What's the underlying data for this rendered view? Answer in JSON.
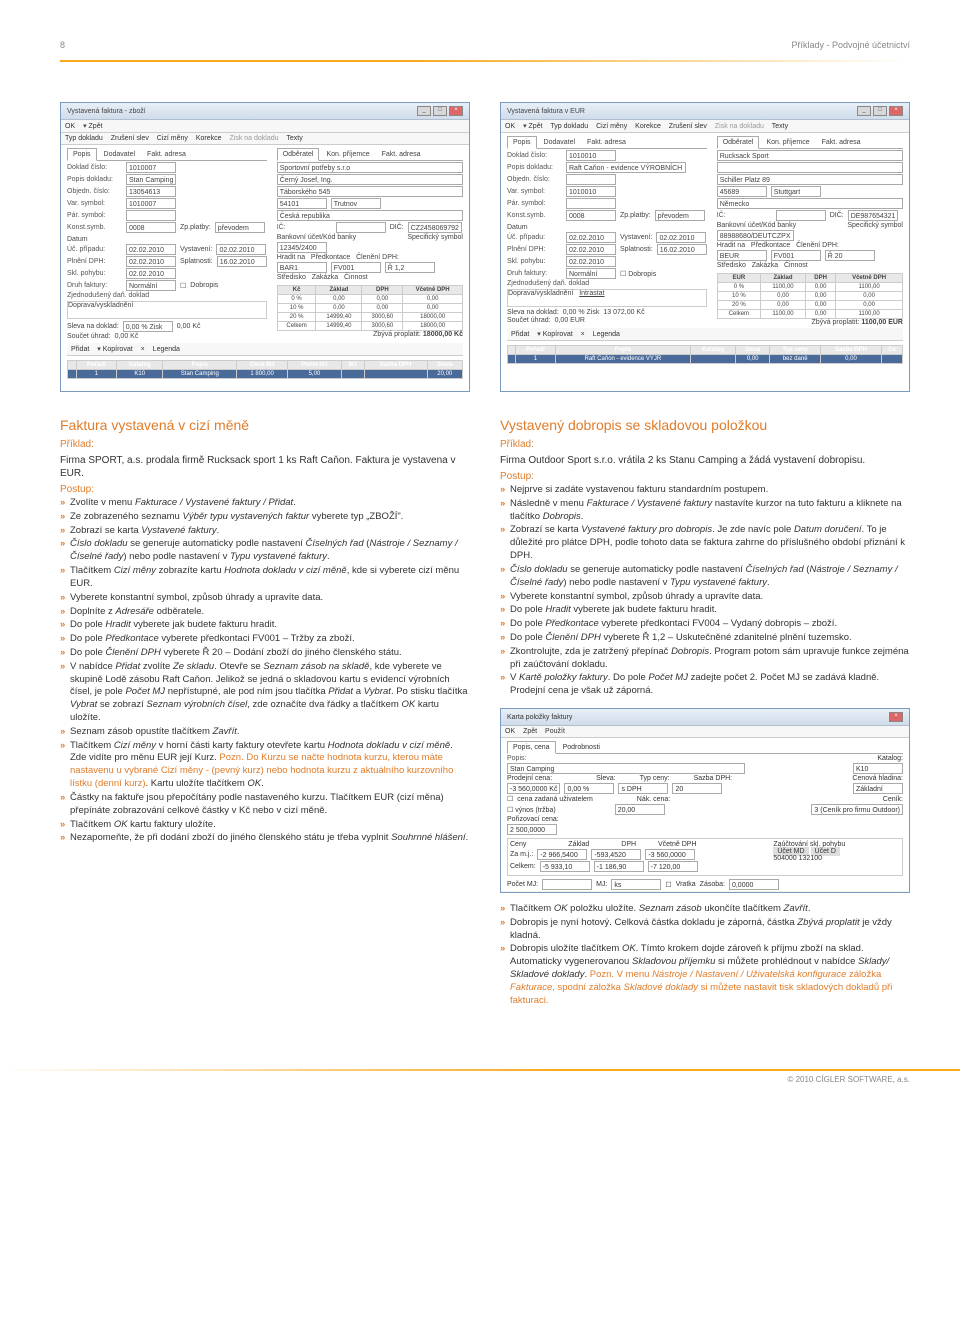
{
  "header": {
    "page_num": "8",
    "section": "Příklady - Podvojné účetnictví"
  },
  "screenshot1": {
    "title": "Vystavená faktura - zboží",
    "toolbar": [
      "OK",
      "Zpět",
      "Typ dokladu",
      "Zrušení slev",
      "Cizí měny",
      "Korekce",
      "Zisk na dokladu",
      "Texty"
    ],
    "tabs_left": [
      "Popis",
      "Dodavatel",
      "Fakt. adresa"
    ],
    "tabs_right": [
      "Odběratel",
      "Kon. příjemce",
      "Fakt. adresa"
    ],
    "fields": {
      "doklad_cislo": "1010007",
      "popis_dokladu": "Stan Camping",
      "objedn_cislo": "13054613",
      "var_symbol": "1010007",
      "odberatel": "Sportovní potřeby s.r.o",
      "os1": "Černý Josef, Ing.",
      "os2": "Táborského 545",
      "psc": "54101",
      "mesto": "Trutnov",
      "zeme": "Česká republika",
      "konst_symb": "0008",
      "zp_platby": "převodem",
      "ic": "",
      "dic": "CZ2458069792",
      "datum_pripadu": "02.02.2010",
      "vystaveni": "02.02.2010",
      "plneni_dph": "02.02.2010",
      "splatnosti": "16.02.2010",
      "skl_pohybu": "02.02.2010",
      "banka": "12345/2400",
      "druh_faktury": "Normální",
      "dobropis_cb": "Dobropis",
      "hradit_na": "BAR1",
      "predkontace": "FV001",
      "cleneni_dph": "Ř 1,2",
      "zjedn_dan": "Zjednodušený daň. doklad",
      "stredisko": "",
      "zakazka": "",
      "cinnost": ""
    },
    "totals": {
      "rows": [
        {
          "r": "0 %",
          "kc": "0,00",
          "zaklad": "0,00",
          "dph": "0,00",
          "vcetne": "0,00"
        },
        {
          "r": "10 %",
          "kc": "0,00",
          "zaklad": "0,00",
          "dph": "",
          "vcetne": "0,00"
        },
        {
          "r": "20 %",
          "kc": "14999,40",
          "zaklad": "3000,60",
          "dph": "",
          "vcetne": "18000,00"
        },
        {
          "r": "Celkem",
          "kc": "14999,40",
          "zaklad": "3000,60",
          "dph": "",
          "vcetne": "18000,00"
        }
      ],
      "zbyva": "18000,00  Kč",
      "sleva": "0,00  %  Zisk",
      "zisk": "0,00 Kč",
      "soucet": "0,00 Kč"
    },
    "grid": {
      "cols": [
        "",
        "Pořadí",
        "Katalog",
        "Popis",
        "Cena MJ",
        "Počet MJ",
        "MJ",
        "Sazba DPH",
        "Sleva"
      ],
      "row": [
        "",
        "1",
        "K10",
        "Stan Camping",
        "1 800,00",
        "5,00",
        "",
        "",
        "20,00"
      ]
    },
    "bottom_bar": [
      "Přidat",
      "Kopírovat",
      "×",
      "Legenda"
    ]
  },
  "screenshot2": {
    "title": "Vystavená faktura v EUR",
    "toolbar": [
      "OK",
      "Zpět",
      "Typ dokladu",
      "Cizí měny",
      "Korekce",
      "Zrušení slev",
      "Zisk na dokladu",
      "Texty"
    ],
    "tabs_left": [
      "Popis",
      "Dodavatel",
      "Fakt. adresa"
    ],
    "tabs_right": [
      "Odběratel",
      "Kon. příjemce",
      "Fakt. adresa"
    ],
    "fields": {
      "doklad_cislo": "1010010",
      "popis_dokladu": "Raft Caňon - evidence VÝROBNÍCH ČÍSE",
      "odberatel": "Rucksack Sport",
      "uice": "Schiller Platz 89",
      "psc": "45689",
      "mesto": "Stuttgart",
      "zeme": "Německo",
      "var_symbol": "1010010",
      "konst_symb": "0008",
      "zp_platby": "převodem",
      "dic": "DE987654321",
      "datum_pripadu": "02.02.2010",
      "vystaveni": "02.02.2010",
      "plneni_dph": "02.02.2010",
      "splatnosti": "16.02.2010",
      "skl_pohybu": "02.02.2010",
      "banka": "88988680/DEUTCZPX",
      "druh_faktury": "Normální",
      "hradit_na": "BEUR",
      "predkontace": "FV001",
      "cleneni_dph": "Ř 20",
      "zjedn_dan": "Zjednodušený daň. doklad",
      "stredisko": "",
      "zakazka": "",
      "cinnost": ""
    },
    "totals": {
      "hdr": "EUR",
      "rows": [
        {
          "r": "0 %",
          "zaklad": "1100,00",
          "dph": "0,00",
          "vcetne": "1100,00"
        },
        {
          "r": "10 %",
          "zaklad": "0,00",
          "dph": "0,00",
          "vcetne": "0,00"
        },
        {
          "r": "20 %",
          "zaklad": "0,00",
          "dph": "0,00",
          "vcetne": "0,00"
        },
        {
          "r": "Celkem",
          "zaklad": "1100,00",
          "dph": "0,00",
          "vcetne": "1100,00"
        }
      ],
      "zbyva": "1100,00  EUR",
      "sleva": "0,00  %  Zisk",
      "zisk": "13 072,00 Kč",
      "soucet": "0,00 EUR"
    },
    "grid": {
      "cols": [
        "",
        "Pořadí",
        "Popis",
        "Katalog",
        "Sleva",
        "Typ ceny",
        "Sazba DPH",
        "Ce"
      ],
      "row": [
        "",
        "1",
        "Raft Caňon - evidence VÝJR",
        "",
        "0,00",
        "bez daně",
        "0,00",
        ""
      ]
    }
  },
  "left_col": {
    "heading": "Faktura vystavená v cizí měně",
    "priklad": "Příklad:",
    "intro": "Firma SPORT, a.s. prodala firmě Rucksack sport 1 ks Raft Caňon. Faktura je vystavena v EUR.",
    "postup": "Postup:",
    "steps": [
      "Zvolíte v menu <em>Fakturace / Vystavené faktury / Přidat</em>.",
      "Ze zobrazeného seznamu <em>Výběr typu vystavených faktur</em> vyberete typ „ZBOŽÍ\".",
      "Zobrazí se karta <em>Vystavené faktury</em>.",
      "<em>Číslo dokladu</em> se generuje automaticky podle nastavení <em>Číselných řad</em> (<em>Nástroje / Seznamy / Číselné řady</em>) nebo podle nastavení v <em>Typu vystavené faktury</em>.",
      "Tlačítkem <em>Cizí měny</em> zobrazíte kartu <em>Hodnota dokladu v cizí měně</em>, kde si vyberete cizí měnu EUR.",
      "Vyberete konstantní symbol, způsob úhrady a upravíte data.",
      "Doplníte z <em>Adresáře</em> odběratele.",
      "Do pole <em>Hradit</em> vyberete jak budete fakturu hradit.",
      "Do pole <em>Předkontace</em> vyberete předkontaci FV001 – Tržby za zboží.",
      "Do pole <em>Členění DPH</em> vyberete Ř 20 – Dodání zboží do jiného členského státu.",
      "V nabídce <em>Přidat</em> zvolíte <em>Ze skladu</em>. Otevře se <em>Seznam zásob na skladě</em>, kde vyberete ve skupině Lodě zásobu Raft Caňon. Jelikož se jedná o skladovou kartu s evidencí výrobních čísel, je pole <em>Počet MJ</em> nepřístupné, ale pod ním jsou tlačítka <em>Přidat</em> a <em>Vybrat</em>. Po stisku tlačítka <em>Vybrat</em> se zobrazí <em>Seznam výrobních čísel</em>, zde označíte dva řádky a tlačítkem <em>OK</em> kartu uložíte.",
      "Seznam zásob opustíte tlačítkem <em>Zavřít</em>.",
      "Tlačítkem <em>Cizí měny</em> v horní části karty faktury otevřete kartu <em>Hodnota dokladu v cizí měně</em>. Zde vidíte pro měnu EUR její Kurz. <span class=\"note-orange\">Pozn. Do Kurzu se načte hodnota kurzu, kterou máte nastavenu u vybrané Cizí měny - (pevný kurz) nebo hodnota kurzu z aktuálního kurzovního lístku (denní kurz)</span>. Kartu uložíte tlačítkem <em>OK</em>.",
      "Částky na faktuře jsou přepočítány podle nastaveného kurzu. Tlačítkem EUR (cizí měna) přepínáte zobrazování celkové částky v Kč nebo v cizí měně.",
      "Tlačítkem <em>OK</em> kartu faktury uložíte.",
      "Nezapomeňte, že při dodání zboží do jiného členského státu je třeba vyplnit <em>Souhrnné hlášení</em>."
    ]
  },
  "right_col": {
    "heading": "Vystavený dobropis se skladovou položkou",
    "priklad": "Příklad:",
    "intro": "Firma Outdoor Sport s.r.o. vrátila 2 ks Stanu Camping a žádá vystavení dobropisu.",
    "postup": "Postup:",
    "steps": [
      "Nejprve si zadáte vystavenou fakturu standardním postupem.",
      "Následně v menu <em>Fakturace / Vystavené faktury</em> nastavíte kurzor na tuto fakturu a kliknete na tlačítko <em>Dobropis</em>.",
      "Zobrazí se karta <em>Vystavené faktury pro dobropis</em>. Je zde navíc pole <em>Datum doručení</em>. To je důležité pro plátce DPH, podle tohoto data se faktura zahrne do příslušného období přiznání k DPH.",
      "<em>Číslo dokladu</em> se generuje automaticky podle nastavení <em>Číselných řad</em> (<em>Nástroje / Seznamy / Číselné řady</em>) nebo podle nastavení v <em>Typu vystavené faktury</em>.",
      "Vyberete konstantní symbol, způsob úhrady a upravíte data.",
      "Do pole <em>Hradit</em> vyberete jak budete fakturu hradit.",
      "Do pole <em>Předkontace</em> vyberete předkontaci FV004 – Vydaný dobropis – zboží.",
      "Do pole <em>Členění DPH</em> vyberete Ř 1,2 – Uskutečněné zdanitelné plnění tuzemsko.",
      "Zkontrolujte, zda je zatržený přepínač <em>Dobropis</em>. Program potom sám upravuje funkce zejména při zaúčtování dokladu.",
      "V <em>Kartě položky faktury</em>. Do pole <em>Počet MJ</em> zadejte počet 2. Počet MJ se zadává kladně. Prodejní cena je však už záporná."
    ],
    "steps2": [
      "Tlačítkem <em>OK</em> položku uložíte. <em>Seznam zásob</em> ukončíte tlačítkem <em>Zavřít</em>.",
      "Dobropis je nyní hotový. Celková částka dokladu je záporná, částka <em>Zbývá proplatit</em> je vždy kladná.",
      "Dobropis uložíte tlačítkem <em>OK</em>. Tímto krokem dojde zároveň k příjmu zboží na sklad. Automaticky vygenerovanou <em>Skladovou příjemku</em> si můžete prohlédnout v nabídce <em>Sklady/ Skladové doklady</em>. <span class=\"note-orange\">Pozn. V menu <em>Nástroje / Nastavení / Uživatelská konfigurace</em> záložka <em>Fakturace</em>, spodní záložka <em>Skladové doklady</em> si můžete nastavit tisk skladových dokladů při fakturaci.</span>"
    ]
  },
  "screenshot3": {
    "title": "Karta položky faktury",
    "toolbar": [
      "OK",
      "Zpět",
      "Použít"
    ],
    "tabs": [
      "Popis, cena",
      "Podrobnosti"
    ],
    "popis": "Stan Camping",
    "katalog": "K10",
    "prodejni_cena": "-3 560,0000  Kč",
    "sleva": "0,00 %",
    "typ_ceny": "s DPH",
    "sazba_dph": "20",
    "cenova_hladina": "Základní",
    "vyn1": "cena zadaná uživatelem",
    "nak_cena": "",
    "cenik": "3 (Ceník pro firmu Outdoor)",
    "poriz_cena": "2 500,0000",
    "ceny": {
      "zami": {
        "zaklad": "-2 966,5400",
        "dph": "-593,4520",
        "vcetne": "-3 560,0000"
      },
      "celkem": {
        "zaklad": "-5 933,10",
        "dph": "-1 186,90",
        "vcetne": "-7 120,00"
      }
    },
    "zauc": {
      "md": "504000",
      "d": "132100"
    },
    "pocet_mj": "",
    "mj": "ks",
    "vratka": "Vratka",
    "zasoba": "0,0000"
  },
  "footer": "© 2010 CÍGLER SOFTWARE, a.s."
}
